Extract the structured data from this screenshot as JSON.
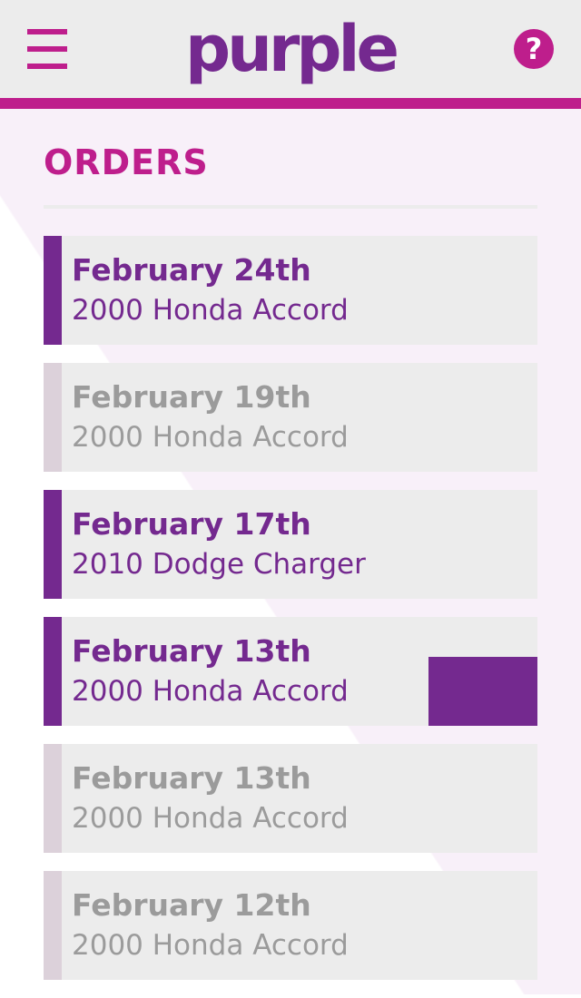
{
  "colors": {
    "accent": "#be1e8c",
    "brand": "#74298f",
    "header_bg": "#ececec",
    "card_bg": "#ececec",
    "inactive_text": "#9b9b9b",
    "inactive_bar": "#dcd1da"
  },
  "header": {
    "menu_icon": "hamburger-menu-icon",
    "logo_text": "purple",
    "help_label": "?"
  },
  "page": {
    "title": "ORDERS"
  },
  "orders": [
    {
      "date": "February 24th",
      "vehicle": "2000 Honda Accord",
      "status": "active"
    },
    {
      "date": "February 19th",
      "vehicle": "2000 Honda Accord",
      "status": "done"
    },
    {
      "date": "February 17th",
      "vehicle": "2010 Dodge Charger",
      "status": "active"
    },
    {
      "date": "February 13th",
      "vehicle": "2000 Honda Accord",
      "status": "active"
    },
    {
      "date": "February 13th",
      "vehicle": "2000 Honda Accord",
      "status": "done"
    },
    {
      "date": "February 12th",
      "vehicle": "2000 Honda Accord",
      "status": "done"
    }
  ]
}
